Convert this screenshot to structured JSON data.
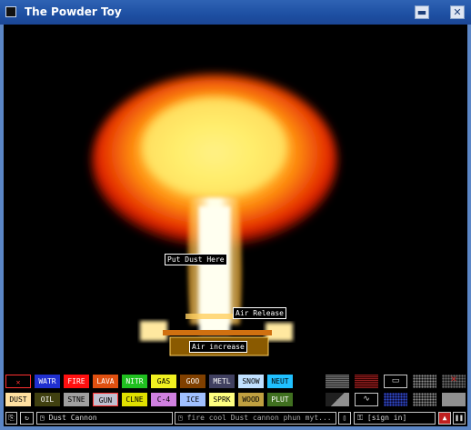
{
  "window": {
    "title": "The Powder Toy",
    "minimize_glyph": "▬",
    "close_glyph": "✕"
  },
  "simulation": {
    "labels": {
      "put_dust": "Put Dust Here",
      "air_release": "Air Release",
      "air_increase": "Air increase"
    }
  },
  "elements_row1": [
    {
      "label": "✕",
      "bg": "#000000",
      "fg": "#ff3030",
      "border": "#ff3030",
      "name": "eraser-tool"
    },
    {
      "label": "WATR",
      "bg": "#2030d0",
      "fg": "#ffffff",
      "name": "element-watr"
    },
    {
      "label": "FIRE",
      "bg": "#ff1010",
      "fg": "#ffffff",
      "name": "element-fire"
    },
    {
      "label": "LAVA",
      "bg": "#e05010",
      "fg": "#ffffff",
      "name": "element-lava"
    },
    {
      "label": "NITR",
      "bg": "#20c020",
      "fg": "#ffffff",
      "name": "element-nitr"
    },
    {
      "label": "GAS",
      "bg": "#f0f020",
      "fg": "#000000",
      "name": "element-gas"
    },
    {
      "label": "GOO",
      "bg": "#804000",
      "fg": "#ffffff",
      "name": "element-goo"
    },
    {
      "label": "METL",
      "bg": "#404060",
      "fg": "#ffffff",
      "name": "element-metl"
    },
    {
      "label": "SNOW",
      "bg": "#c0e0ff",
      "fg": "#000000",
      "name": "element-snow"
    },
    {
      "label": "NEUT",
      "bg": "#20c0ff",
      "fg": "#000000",
      "name": "element-neut"
    }
  ],
  "elements_row2": [
    {
      "label": "DUST",
      "bg": "#ffe0a0",
      "fg": "#000000",
      "name": "element-dust"
    },
    {
      "label": "OIL",
      "bg": "#404010",
      "fg": "#ffffff",
      "name": "element-oil"
    },
    {
      "label": "STNE",
      "bg": "#a0a0a0",
      "fg": "#000000",
      "name": "element-stne"
    },
    {
      "label": "GUN",
      "bg": "#c0c0d0",
      "fg": "#000000",
      "border": "#ff3030",
      "name": "element-gun"
    },
    {
      "label": "CLNE",
      "bg": "#e0e000",
      "fg": "#000000",
      "name": "element-clne"
    },
    {
      "label": "C-4",
      "bg": "#d080e0",
      "fg": "#000000",
      "name": "element-c4"
    },
    {
      "label": "ICE",
      "bg": "#a0c0ff",
      "fg": "#000000",
      "name": "element-ice"
    },
    {
      "label": "SPRK",
      "bg": "#ffff80",
      "fg": "#000000",
      "name": "element-sprk"
    },
    {
      "label": "WOOD",
      "bg": "#c0a040",
      "fg": "#000000",
      "name": "element-wood"
    },
    {
      "label": "PLUT",
      "bg": "#407020",
      "fg": "#ffffff",
      "name": "element-plut"
    }
  ],
  "walls_row1": [
    {
      "name": "wall-basic-button",
      "style": "hatch-gray"
    },
    {
      "name": "wall-conductor-button",
      "style": "hatch-red"
    },
    {
      "name": "wall-sign-button",
      "style": "sign"
    },
    {
      "name": "wall-fan-button",
      "style": "dots-gray"
    },
    {
      "name": "wall-eraser-button",
      "style": "eraser"
    }
  ],
  "walls_row2": [
    {
      "name": "wall-stream-button",
      "style": "diag-gray"
    },
    {
      "name": "wall-wave-button",
      "style": "wave"
    },
    {
      "name": "wall-water-button",
      "style": "dots-blue"
    },
    {
      "name": "wall-gas-button",
      "style": "dots-gray"
    },
    {
      "name": "wall-solid-button",
      "style": "solid-gray"
    }
  ],
  "bottom_bar": {
    "save_name": "Dust Cannon",
    "tags": "fire cool Dust cannon phun myt...",
    "sign_in": "[sign in]",
    "pause_glyph": "❚❚"
  }
}
